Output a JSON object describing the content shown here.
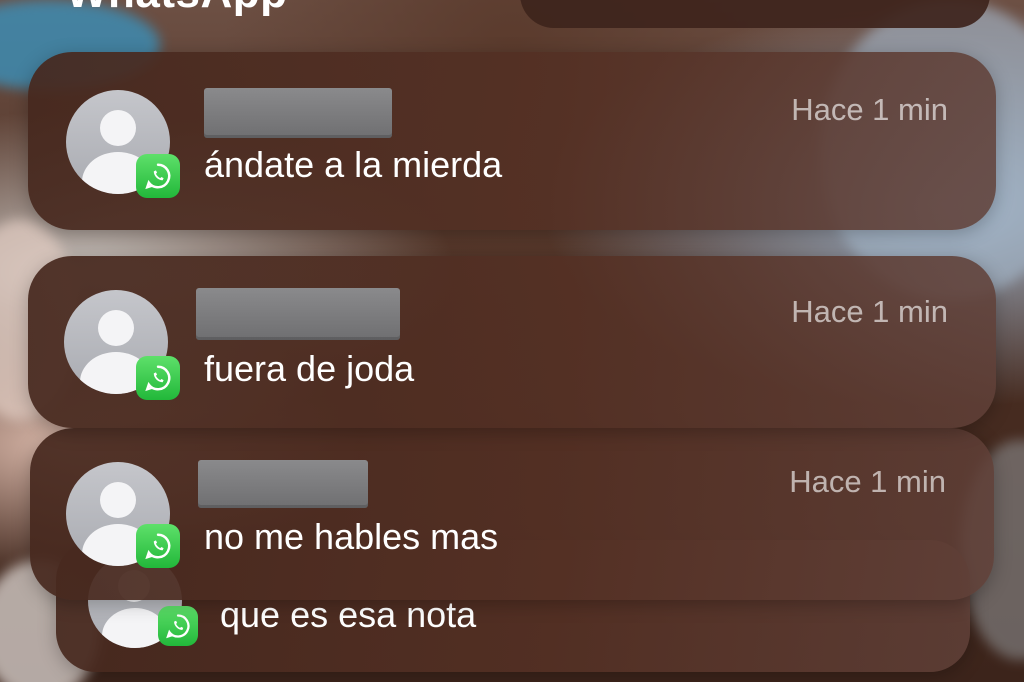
{
  "app_title": "WhatsApp",
  "notifications": [
    {
      "time": "Hace 1 min",
      "message": "ándate a la mierda"
    },
    {
      "time": "Hace 1 min",
      "message": "fuera de joda"
    },
    {
      "time": "Hace 1 min",
      "message": "no me hables mas"
    },
    {
      "message": "que es esa nota"
    }
  ],
  "icons": {
    "avatar": "person-placeholder-icon",
    "badge": "whatsapp-icon"
  },
  "colors": {
    "whatsapp_green": "#25D366",
    "card_bg": "#4a2c22",
    "time_text": "#bfb3ae"
  }
}
